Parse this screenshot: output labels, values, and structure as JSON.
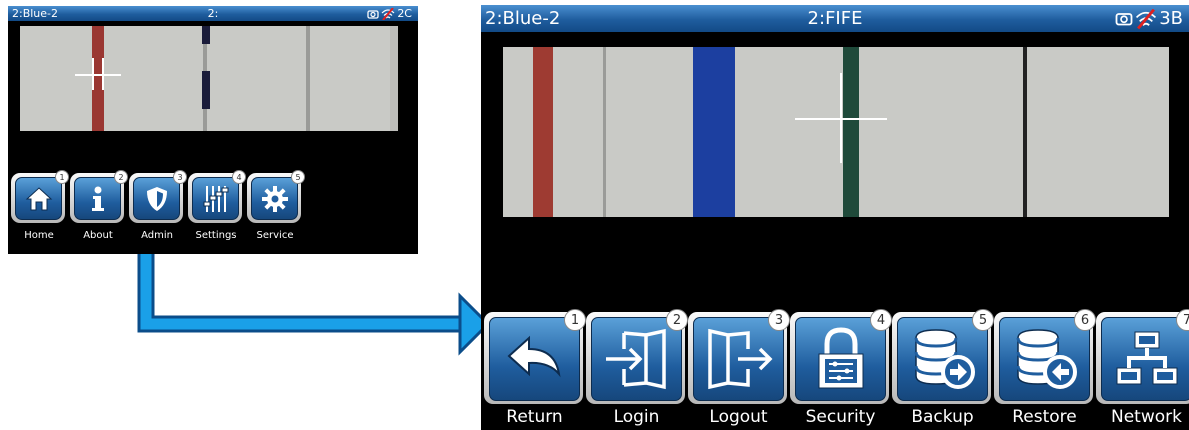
{
  "screen1": {
    "status": {
      "left": "2:Blue-2",
      "center": "2:",
      "right": "2C"
    },
    "buttons": [
      {
        "label": "Home",
        "badge": "1",
        "icon": "home-icon"
      },
      {
        "label": "About",
        "badge": "2",
        "icon": "info-icon"
      },
      {
        "label": "Admin",
        "badge": "3",
        "icon": "shield-icon"
      },
      {
        "label": "Settings",
        "badge": "4",
        "icon": "sliders-icon"
      },
      {
        "label": "Service",
        "badge": "5",
        "icon": "gear-icon"
      }
    ]
  },
  "screen2": {
    "status": {
      "left": "2:Blue-2",
      "center": "2:FIFE",
      "right": "3B"
    },
    "buttons": [
      {
        "label": "Return",
        "badge": "1",
        "icon": "return-icon"
      },
      {
        "label": "Login",
        "badge": "2",
        "icon": "login-icon"
      },
      {
        "label": "Logout",
        "badge": "3",
        "icon": "logout-icon"
      },
      {
        "label": "Security",
        "badge": "4",
        "icon": "lock-icon"
      },
      {
        "label": "Backup",
        "badge": "5",
        "icon": "database-backup-icon"
      },
      {
        "label": "Restore",
        "badge": "6",
        "icon": "database-restore-icon"
      },
      {
        "label": "Network",
        "badge": "7",
        "icon": "network-icon"
      }
    ]
  },
  "colors": {
    "status_bar": "#1f5d9e",
    "button_face": "#1f5d9e",
    "arrow": "#1aa0e8",
    "stripe_red": "#a03a33",
    "stripe_blue": "#1c3fa0",
    "stripe_green": "#1f4a3a"
  }
}
